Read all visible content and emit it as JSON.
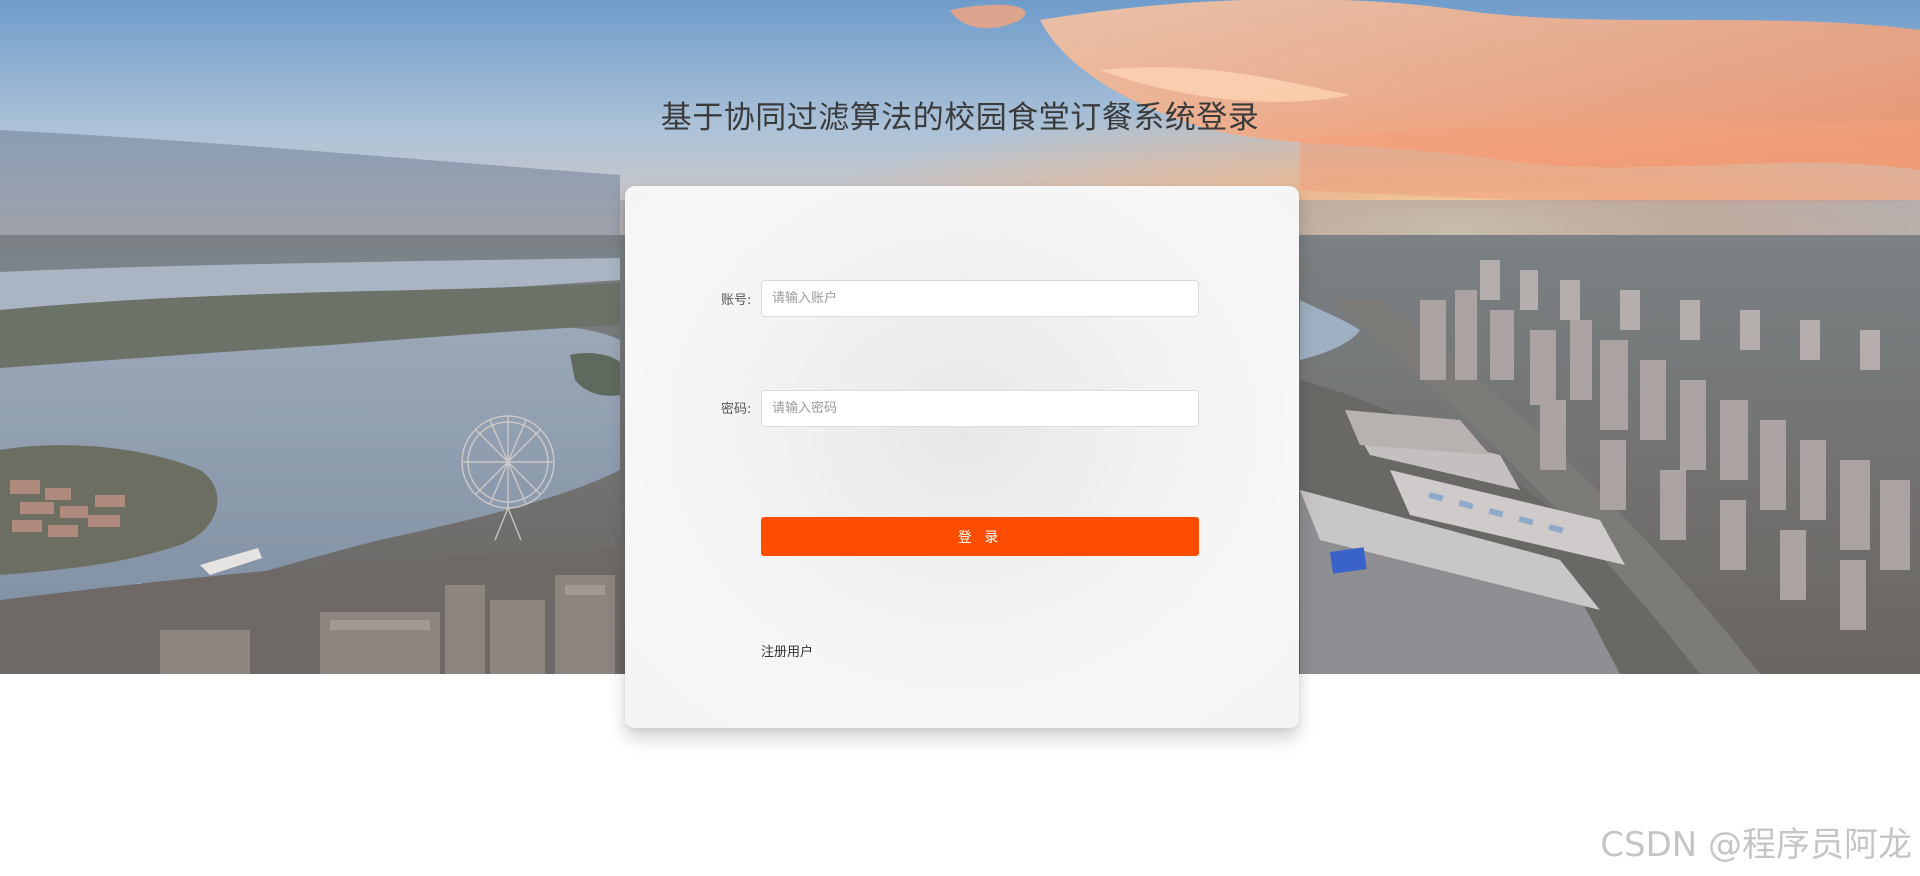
{
  "page": {
    "title": "基于协同过滤算法的校园食堂订餐系统登录"
  },
  "login_form": {
    "account_label": "账号:",
    "account_placeholder": "请输入账户",
    "account_value": "",
    "password_label": "密码:",
    "password_placeholder": "请输入密码",
    "password_value": "",
    "submit_label": "登 录",
    "register_label": "注册用户"
  },
  "watermark": {
    "text": "CSDN @程序员阿龙"
  },
  "colors": {
    "accent": "#ff4d00",
    "title_text": "#3b3b3b",
    "card_background": "#f4f4f4",
    "page_background": "#ffffff"
  },
  "background": {
    "image": "aerial-city-lake-sunset"
  }
}
